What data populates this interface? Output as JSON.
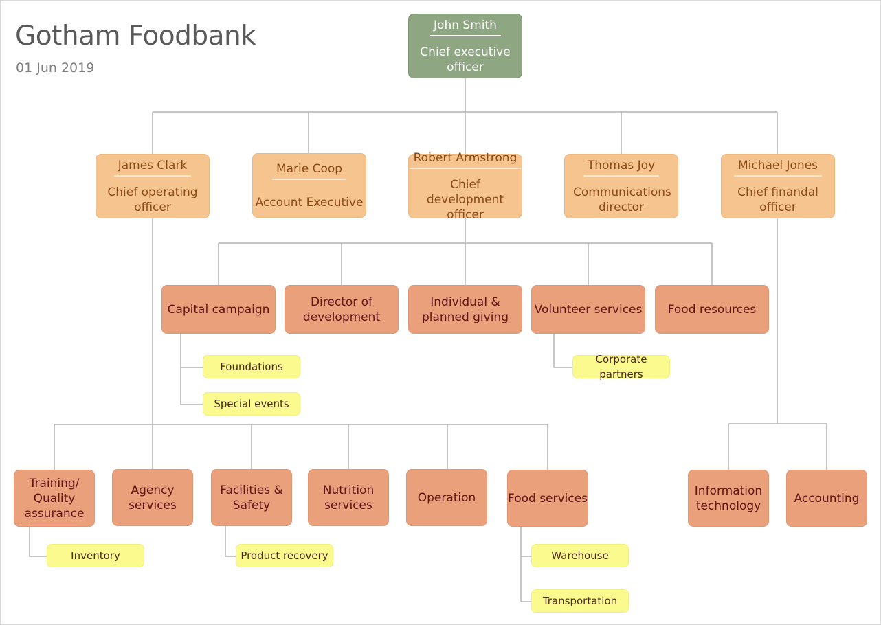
{
  "header": {
    "title": "Gotham Foodbank",
    "date": "01 Jun 2019"
  },
  "ceo": {
    "name": "John Smith",
    "role": "Chief executive officer",
    "color": "#8ea682"
  },
  "executives": [
    {
      "name": "James Clark",
      "role": "Chief operating officer"
    },
    {
      "name": "Marie Coop",
      "role": "Account Executive"
    },
    {
      "name": "Robert Armstrong",
      "role": "Chief development officer"
    },
    {
      "name": "Thomas Joy",
      "role": "Communications director"
    },
    {
      "name": "Michael Jones",
      "role": "Chief finandal officer"
    }
  ],
  "development_departments": [
    {
      "label": "Capital campaign",
      "subunits": [
        "Foundations",
        "Special events"
      ]
    },
    {
      "label": "Director of development",
      "subunits": []
    },
    {
      "label": "Individual & planned giving",
      "subunits": []
    },
    {
      "label": "Volunteer services",
      "subunits": [
        "Corporate partners"
      ]
    },
    {
      "label": "Food resources",
      "subunits": []
    }
  ],
  "operations_departments": [
    {
      "label": "Training/ Quality assurance",
      "subunits": [
        "Inventory"
      ]
    },
    {
      "label": "Agency services",
      "subunits": []
    },
    {
      "label": "Facilities & Safety",
      "subunits": [
        "Product recovery"
      ]
    },
    {
      "label": "Nutrition services",
      "subunits": []
    },
    {
      "label": "Operation",
      "subunits": []
    },
    {
      "label": "Food services",
      "subunits": [
        "Warehouse",
        "Transportation"
      ]
    }
  ],
  "finance_departments": [
    {
      "label": "Information technology",
      "subunits": []
    },
    {
      "label": "Accounting",
      "subunits": []
    }
  ],
  "colors": {
    "executive": "#f5c48f",
    "department": "#eba07c",
    "subunit": "#fafa8e",
    "connector": "#b3b3b3"
  }
}
